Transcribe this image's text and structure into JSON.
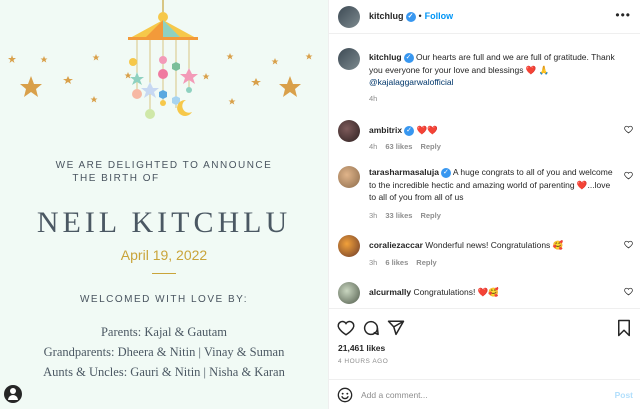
{
  "image": {
    "announce_line1": "WE ARE DELIGHTED TO ANNOUNCE",
    "announce_line2": "THE BIRTH OF",
    "baby_name": "NEIL KITCHLU",
    "birth_date": "April 19, 2022",
    "welcomed": "WELCOMED WITH LOVE BY:",
    "family": [
      "Parents: Kajal & Gautam",
      "Grandparents: Dheera & Nitin | Vinay & Suman",
      "Aunts & Uncles: Gauri & Nitin | Nisha & Karan"
    ],
    "colors": {
      "background": "#f1faf5",
      "gold": "#c9a43a",
      "text": "#4b5863"
    }
  },
  "header": {
    "username": "kitchlug",
    "dot": "•",
    "follow_label": "Follow",
    "more_icon": "more-horizontal-icon"
  },
  "caption": {
    "username": "kitchlug",
    "text": "Our hearts are full and we are full of gratitude. Thank you everyone for your love and blessings",
    "emojis": "❤️ 🙏",
    "mention": "@kajalaggarwalofficial",
    "time": "4h"
  },
  "comments": [
    {
      "username": "ambitrix",
      "text": "",
      "emojis": "❤️❤️",
      "time": "4h",
      "likes": "63 likes",
      "reply": "Reply"
    },
    {
      "username": "tarasharmasaluja",
      "text": "A huge congrats to all of you and welcome to the incredible hectic and amazing world of parenting",
      "emojis": "❤️",
      "text_after": "...love to all of you from all of us",
      "time": "3h",
      "likes": "33 likes",
      "reply": "Reply"
    },
    {
      "username": "coraliezaccar",
      "text": "Wonderful news! Congratulations",
      "emojis": "🥰",
      "time": "3h",
      "likes": "6 likes",
      "reply": "Reply"
    },
    {
      "username": "alcurmally",
      "text": "Congratulations!",
      "emojis": "❤️🥰",
      "time": "",
      "likes": "",
      "reply": ""
    }
  ],
  "stats": {
    "likes": "21,461 likes",
    "time": "4 HOURS AGO"
  },
  "comment_box": {
    "placeholder": "Add a comment...",
    "post_label": "Post"
  },
  "accent_color": "#0095f6"
}
